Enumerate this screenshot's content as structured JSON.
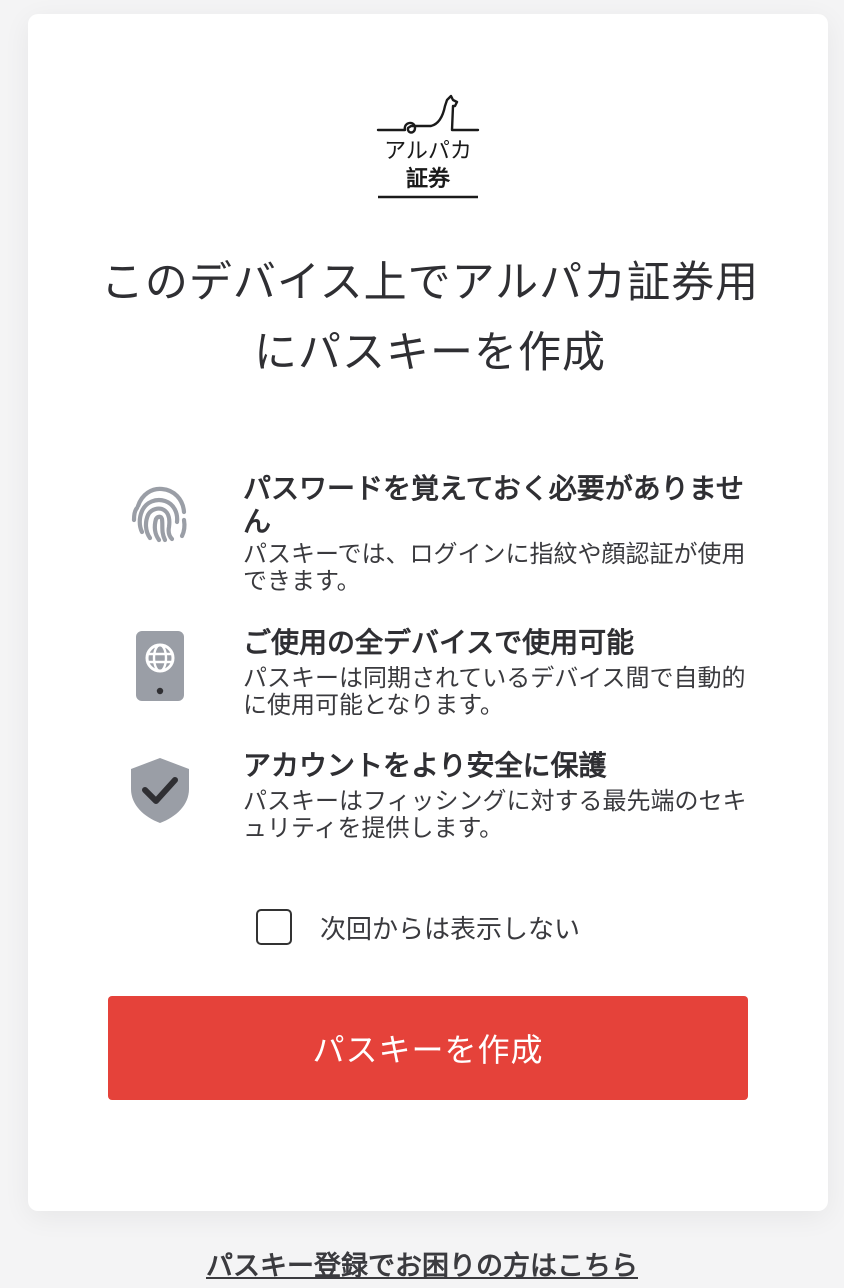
{
  "logo": {
    "line1": "アルパカ",
    "line2": "証券"
  },
  "title": "このデバイス上でアルパカ証券用にパスキーを作成",
  "features": [
    {
      "icon": "fingerprint-icon",
      "title": "パスワードを覚えておく必要がありません",
      "desc": "パスキーでは、ログインに指紋や顔認証が使用できます。"
    },
    {
      "icon": "device-sync-icon",
      "title": "ご使用の全デバイスで使用可能",
      "desc": "パスキーは同期されているデバイス間で自動的に使用可能となります。"
    },
    {
      "icon": "shield-check-icon",
      "title": "アカウントをより安全に保護",
      "desc": "パスキーはフィッシングに対する最先端のセキュリティを提供します。"
    }
  ],
  "checkbox": {
    "label": "次回からは表示しない",
    "checked": false
  },
  "primary_button": "パスキーを作成",
  "help_link": "パスキー登録でお困りの方はこちら",
  "colors": {
    "accent": "#e5423a",
    "icon_gray": "#9a9ea6",
    "background": "#f4f4f5"
  }
}
